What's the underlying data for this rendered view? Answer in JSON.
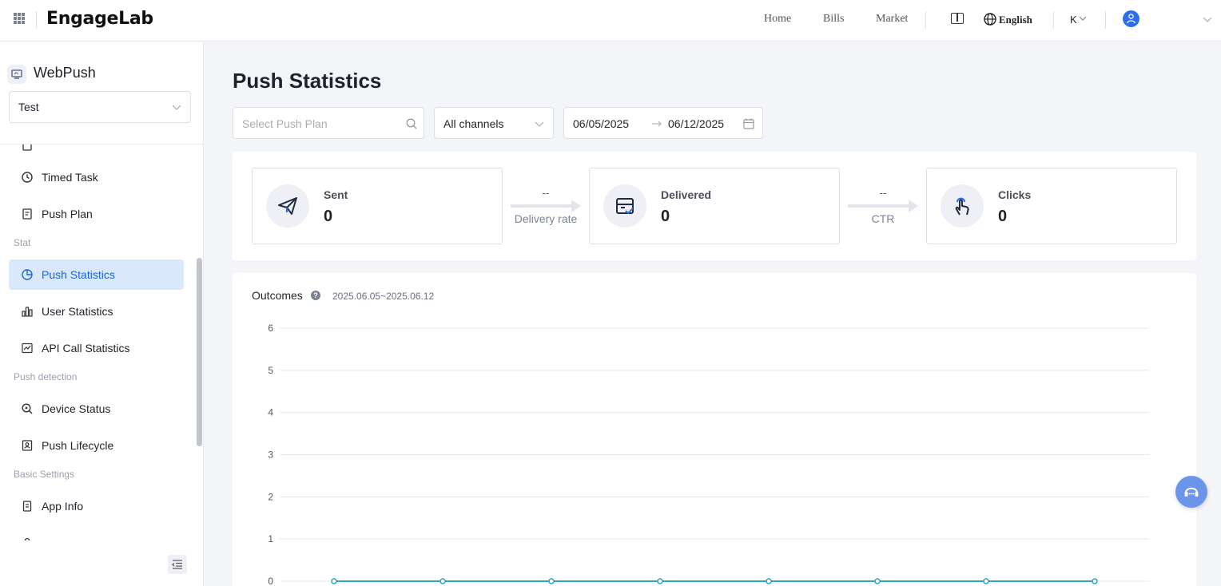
{
  "topbar": {
    "logo": "EngageLab",
    "nav": [
      "Home",
      "Bills",
      "Market"
    ],
    "language": "English",
    "account_initial": "K"
  },
  "sidebar": {
    "app_name": "WebPush",
    "app_select_value": "Test",
    "groups": {
      "stat": "Stat",
      "push_detection": "Push detection",
      "basic_settings": "Basic Settings"
    },
    "items": {
      "timed_task": "Timed Task",
      "push_plan": "Push Plan",
      "push_statistics": "Push Statistics",
      "user_statistics": "User Statistics",
      "api_call_statistics": "API Call Statistics",
      "device_status": "Device Status",
      "push_lifecycle": "Push Lifecycle",
      "app_info": "App Info"
    }
  },
  "main": {
    "title": "Push Statistics",
    "filters": {
      "push_plan_placeholder": "Select Push Plan",
      "channel_value": "All channels",
      "date_start": "06/05/2025",
      "date_end": "06/12/2025"
    },
    "funnel": {
      "sent": {
        "label": "Sent",
        "value": "0"
      },
      "delivery_rate": {
        "value": "--",
        "label": "Delivery rate"
      },
      "delivered": {
        "label": "Delivered",
        "value": "0"
      },
      "ctr": {
        "value": "--",
        "label": "CTR"
      },
      "clicks": {
        "label": "Clicks",
        "value": "0"
      }
    },
    "outcomes": {
      "title": "Outcomes",
      "help": "?",
      "range": "2025.06.05~2025.06.12"
    }
  },
  "chart_data": {
    "type": "line",
    "title": "Outcomes",
    "series": [
      {
        "values": [
          0,
          0,
          0,
          0,
          0,
          0,
          0,
          0
        ]
      }
    ],
    "ylim": [
      0,
      6
    ],
    "yticks": [
      0,
      1,
      2,
      3,
      4,
      5,
      6
    ],
    "grid": true
  },
  "colors": {
    "accent": "#1a64d6",
    "active_bg": "#d9e8fb",
    "line": "#2aa3c7"
  }
}
